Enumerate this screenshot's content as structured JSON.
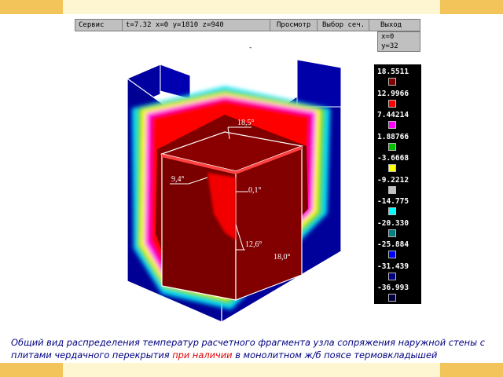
{
  "toolbar": {
    "service_label": "Сервис",
    "coords_label": "t=7.32 x=0 y=1810 z=940",
    "view_label": "Просмотр",
    "select_section_label": "Выбор сеч.",
    "exit_label": "Выход"
  },
  "coord_readout": {
    "x": "x=0",
    "y": "y=32"
  },
  "dash_mark": "-",
  "legend": {
    "items": [
      {
        "value": "18.5511",
        "color": "#800000"
      },
      {
        "value": "12.9966",
        "color": "#ff0000"
      },
      {
        "value": "7.44214",
        "color": "#ff00ff"
      },
      {
        "value": "1.88766",
        "color": "#00c000"
      },
      {
        "value": "-3.6668",
        "color": "#ffff00"
      },
      {
        "value": "-9.2212",
        "color": "#c0c0c0"
      },
      {
        "value": "-14.775",
        "color": "#00ffff"
      },
      {
        "value": "-20.330",
        "color": "#008080"
      },
      {
        "value": "-25.884",
        "color": "#0000ff"
      },
      {
        "value": "-31.439",
        "color": "#000080"
      },
      {
        "value": "-36.993",
        "color": "#000040"
      }
    ]
  },
  "scene": {
    "annotations": {
      "top": "18,5°",
      "left": "9,4°",
      "corner": "0,1°",
      "edge": "12,6°",
      "face": "18,0°"
    },
    "colors": {
      "wall": "#0000a0",
      "outline": "#ffffff",
      "inner": "#800000",
      "hot": "#ff0000"
    }
  },
  "caption": {
    "part1": "Общий вид распределения температур расчетного фрагмента узла сопряжения наружной стены с плитами чердачного перекрытия ",
    "highlight": "при наличии",
    "part2": " в монолитном ж/б поясе термовкладышей"
  }
}
